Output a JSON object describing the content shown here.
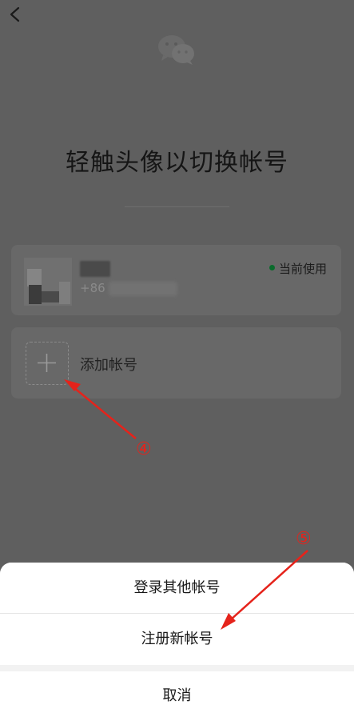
{
  "page": {
    "title": "轻触头像以切换帐号",
    "back_icon": "chevron-left-icon",
    "logo_icon": "wechat-logo-icon"
  },
  "accounts": {
    "current": {
      "phone_prefix": "+86",
      "status_label": "当前使用",
      "status_color": "#0a6b2c"
    },
    "add": {
      "label": "添加帐号",
      "icon": "plus-icon"
    }
  },
  "annotations": {
    "step4": "④",
    "step5": "⑤",
    "color": "#e5231b"
  },
  "sheet": {
    "login_other": "登录其他帐号",
    "register_new": "注册新帐号",
    "cancel": "取消"
  }
}
